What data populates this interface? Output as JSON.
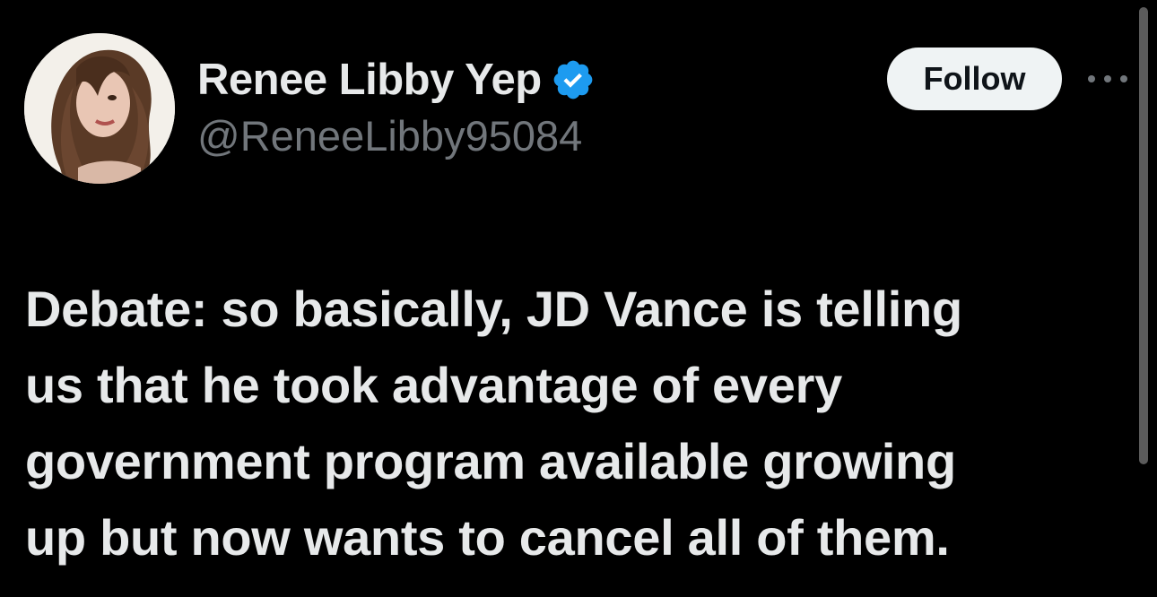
{
  "author": {
    "display_name": "Renee Libby Yep",
    "handle": "@ReneeLibby95084",
    "verified": true,
    "avatar_icon": "profile-photo",
    "verified_icon": "verified-badge-icon"
  },
  "actions": {
    "follow_label": "Follow",
    "more_icon": "more-options-icon"
  },
  "tweet": {
    "lines": [
      "Debate: so basically, JD Vance is telling",
      "us that he took advantage of every",
      "government program available growing",
      "up but now wants to cancel all of them."
    ]
  },
  "colors": {
    "background": "#000000",
    "text_primary": "#e7e9ea",
    "text_secondary": "#71767b",
    "verified_blue": "#1d9bf0",
    "follow_bg": "#eff3f4",
    "follow_text": "#0f1419"
  }
}
